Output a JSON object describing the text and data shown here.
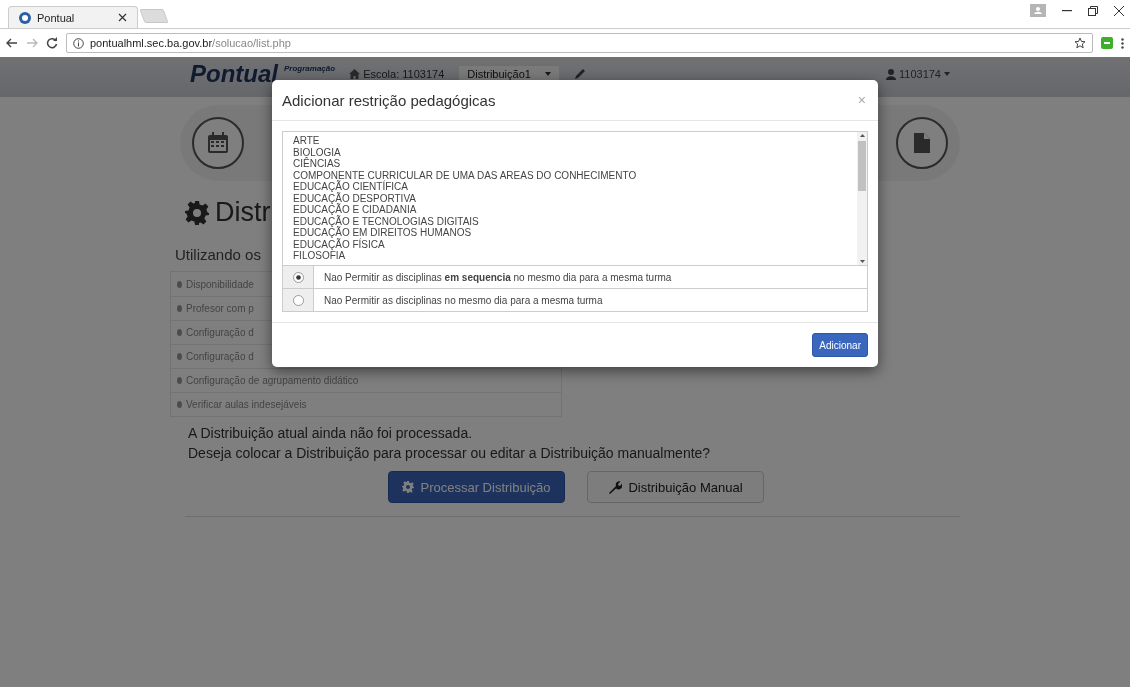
{
  "browser": {
    "tab_title": "Pontual",
    "url_host": "pontualhml.sec.ba.gov.br",
    "url_path": "/solucao/list.php"
  },
  "navbar": {
    "brand": "Pontual",
    "subtitle": "Programação",
    "school": "Escola: 1103174",
    "distribution": "Distribuição1",
    "user": "1103174"
  },
  "page": {
    "heading": "Distr",
    "intro": "Utilizando os",
    "checks": [
      "Disponibilidade",
      "Profesor com p",
      "Configuração d",
      "Configuração d",
      "Configuração de agrupamento didático",
      "Verificar aulas indesejáveis"
    ],
    "message_lines": [
      "A Distribuição atual ainda não foi processada.",
      "Deseja colocar a Distribuição para processar ou editar a Distribuição manualmente?"
    ],
    "buttons": [
      {
        "label": "Processar Distribuição",
        "kind": "primary"
      },
      {
        "label": "Distribuição Manual",
        "kind": "default"
      }
    ]
  },
  "modal": {
    "title": "Adicionar restrição pedagógicas",
    "close": "×",
    "subjects": [
      "ARTE",
      "BIOLOGIA",
      "CIÊNCIAS",
      "COMPONENTE CURRICULAR DE UMA DAS AREAS DO CONHECIMENTO",
      "EDUCAÇÃO CIENTÍFICA",
      "EDUCAÇÃO DESPORTIVA",
      "EDUCAÇÃO E CIDADANIA",
      "EDUCAÇÃO E TECNOLOGIAS DIGITAIS",
      "EDUCAÇÃO EM DIREITOS HUMANOS",
      "EDUCAÇÃO FÍSICA",
      "FILOSOFIA"
    ],
    "options": [
      {
        "label": "Nao Permitir as disciplinas **em sequencia** no mesmo dia para a mesma turma",
        "selected": true
      },
      {
        "label": "Nao Permitir as disciplinas no mesmo dia para a mesma turma",
        "selected": false
      }
    ],
    "submit": "Adicionar"
  }
}
